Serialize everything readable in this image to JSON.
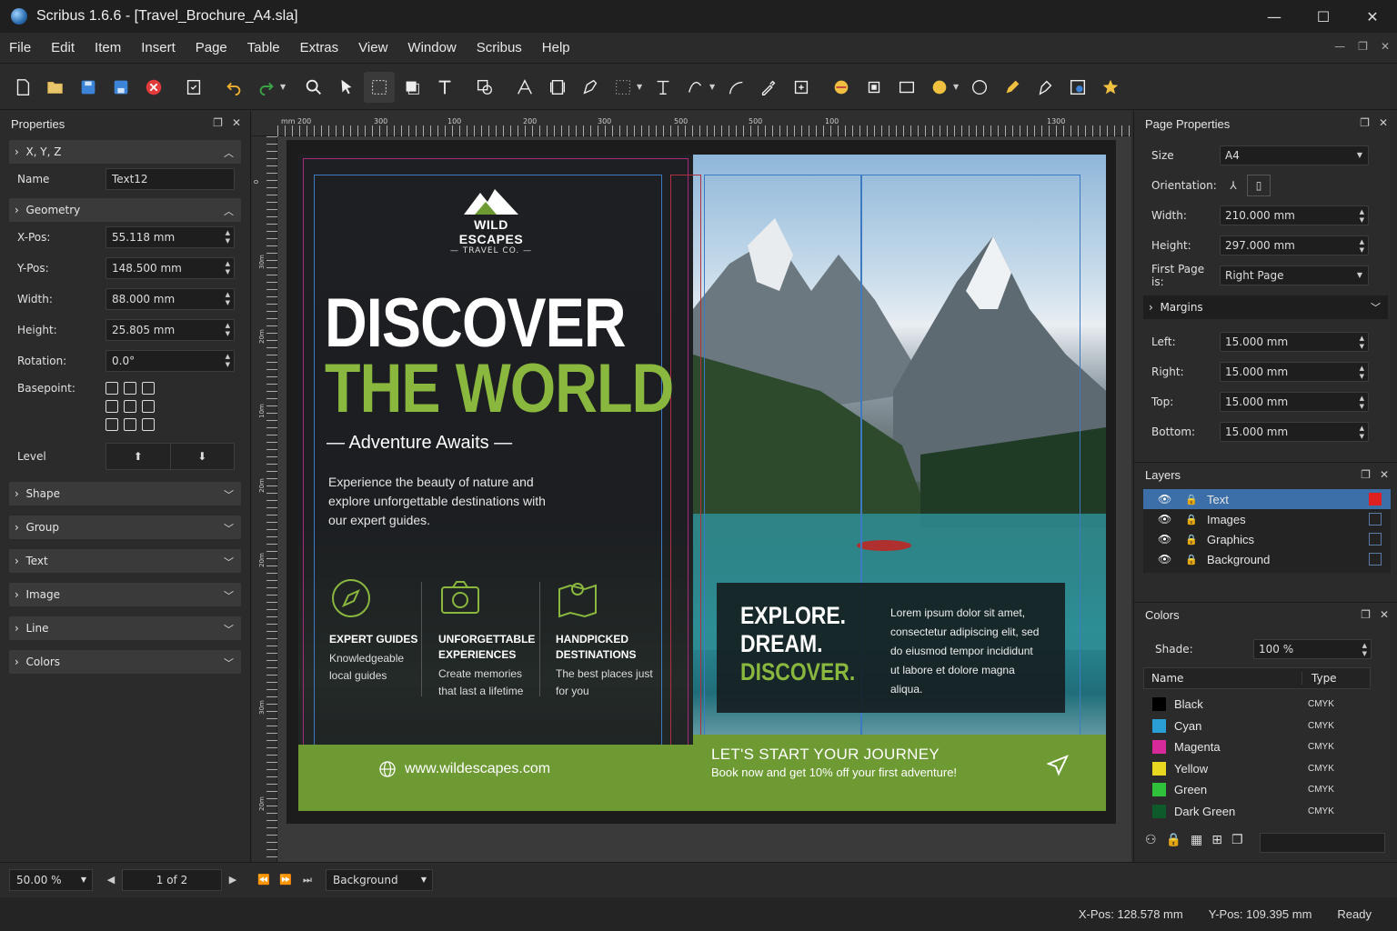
{
  "window": {
    "title": "Scribus 1.6.6 - [Travel_Brochure_A4.sla]",
    "minimize": "—",
    "maximize": "☐",
    "close": "✕"
  },
  "menu": [
    "File",
    "Edit",
    "Item",
    "Insert",
    "Page",
    "Table",
    "Extras",
    "View",
    "Window",
    "Scribus",
    "Help"
  ],
  "properties": {
    "title": "Properties",
    "xyz_label": "X, Y, Z",
    "name_label": "Name",
    "name_value": "Text12",
    "geometry_label": "Geometry",
    "xpos_label": "X-Pos:",
    "xpos_value": "55.118 mm",
    "ypos_label": "Y-Pos:",
    "ypos_value": "148.500 mm",
    "width_label": "Width:",
    "width_value": "88.000 mm",
    "height_label": "Height:",
    "height_value": "25.805 mm",
    "rotation_label": "Rotation:",
    "rotation_value": "0.0°",
    "basepoint_label": "Basepoint:",
    "level_label": "Level",
    "sections": [
      "Shape",
      "Group",
      "Text",
      "Image",
      "Line",
      "Colors"
    ]
  },
  "ruler": {
    "unit": "mm",
    "top_ticks": [
      "200",
      "300",
      "100",
      "200",
      "300",
      "500",
      "500",
      "100",
      "1300"
    ],
    "left_ticks": [
      "0",
      "30m",
      "20m",
      "10m",
      "20m",
      "20m",
      "30m",
      "20m"
    ]
  },
  "brochure": {
    "logo_name": "WILD ESCAPES",
    "logo_sub": "— TRAVEL CO. —",
    "headline1": "DISCOVER",
    "headline2": "THE WORLD",
    "tagline": "— Adventure Awaits —",
    "body": "Experience the beauty of nature and explore unforgettable destinations with our expert guides.",
    "features": [
      {
        "title": "EXPERT GUIDES",
        "desc": "Knowledgeable local guides"
      },
      {
        "title": "UNFORGETTABLE EXPERIENCES",
        "desc": "Create memories that last a lifetime"
      },
      {
        "title": "HANDPICKED DESTINATIONS",
        "desc": "The best places just for you"
      }
    ],
    "url": "www.wildescapes.com",
    "explore": [
      "EXPLORE.",
      "DREAM.",
      "DISCOVER."
    ],
    "lorem": "Lorem ipsum dolor sit amet, consectetur adipiscing elit, sed do eiusmod tempor incididunt ut labore et dolore magna aliqua.",
    "journey_title": "LET'S START YOUR JOURNEY",
    "journey_sub": "Book now and get 10% off your first adventure!"
  },
  "page_properties": {
    "title": "Page Properties",
    "size_label": "Size",
    "size_value": "A4",
    "orientation_label": "Orientation:",
    "width_label": "Width:",
    "width_value": "210.000 mm",
    "height_label": "Height:",
    "height_value": "297.000 mm",
    "first_page_label": "First Page is:",
    "first_page_value": "Right Page",
    "margins_label": "Margins",
    "left_label": "Left:",
    "left_value": "15.000 mm",
    "right_label": "Right:",
    "right_value": "15.000 mm",
    "top_label": "Top:",
    "top_value": "15.000 mm",
    "bottom_label": "Bottom:",
    "bottom_value": "15.000 mm"
  },
  "layers": {
    "title": "Layers",
    "items": [
      {
        "name": "Text",
        "color": "#e02020"
      },
      {
        "name": "Images",
        "color": "#2b2b2b"
      },
      {
        "name": "Graphics",
        "color": "#2b2b2b"
      },
      {
        "name": "Background",
        "color": "#2b2b2b"
      }
    ]
  },
  "colors_panel": {
    "title": "Colors",
    "shade_label": "Shade:",
    "shade_value": "100 %",
    "col_name": "Name",
    "col_type": "Type",
    "items": [
      {
        "name": "Black",
        "type": "CMYK",
        "hex": "#000000"
      },
      {
        "name": "Cyan",
        "type": "CMYK",
        "hex": "#2a9fd6"
      },
      {
        "name": "Magenta",
        "type": "CMYK",
        "hex": "#d62a9a"
      },
      {
        "name": "Yellow",
        "type": "CMYK",
        "hex": "#e8d820"
      },
      {
        "name": "Green",
        "type": "CMYK",
        "hex": "#2fc23a"
      },
      {
        "name": "Dark Green",
        "type": "CMYK",
        "hex": "#0f5a2a"
      }
    ]
  },
  "zoombar": {
    "zoom": "50.00 %",
    "page": "1 of 2",
    "layer": "Background"
  },
  "status": {
    "xpos": "X-Pos: 128.578 mm",
    "ypos": "Y-Pos: 109.395 mm",
    "state": "Ready"
  }
}
